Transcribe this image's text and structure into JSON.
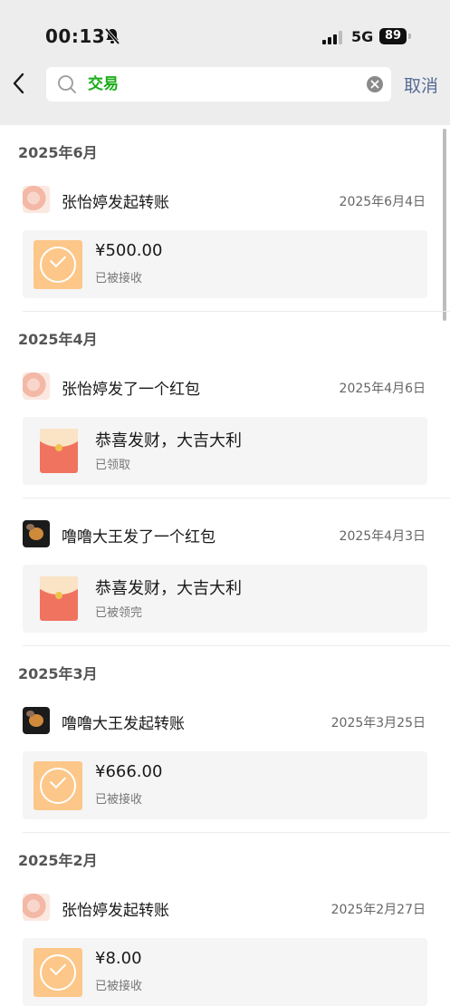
{
  "status_bar": {
    "time": "00:13",
    "network": "5G",
    "battery": "89"
  },
  "search": {
    "query": "交易",
    "cancel_label": "取消"
  },
  "sections": [
    {
      "month": "2025年6月",
      "items": [
        {
          "title": "张怡婷发起转账",
          "date": "2025年6月4日",
          "kind": "transfer",
          "main": "¥500.00",
          "sub": "已被接收"
        }
      ]
    },
    {
      "month": "2025年4月",
      "items": [
        {
          "title": "张怡婷发了一个红包",
          "date": "2025年4月6日",
          "kind": "red-packet",
          "main": "恭喜发财，大吉大利",
          "sub": "已领取"
        },
        {
          "title": "噜噜大王发了一个红包",
          "date": "2025年4月3日",
          "kind": "red-packet",
          "main": "恭喜发财，大吉大利",
          "sub": "已被领完"
        }
      ]
    },
    {
      "month": "2025年3月",
      "items": [
        {
          "title": "噜噜大王发起转账",
          "date": "2025年3月25日",
          "kind": "transfer",
          "main": "¥666.00",
          "sub": "已被接收"
        }
      ]
    },
    {
      "month": "2025年2月",
      "items": [
        {
          "title": "张怡婷发起转账",
          "date": "2025年2月27日",
          "kind": "transfer",
          "main": "¥8.00",
          "sub": "已被接收"
        }
      ]
    }
  ]
}
